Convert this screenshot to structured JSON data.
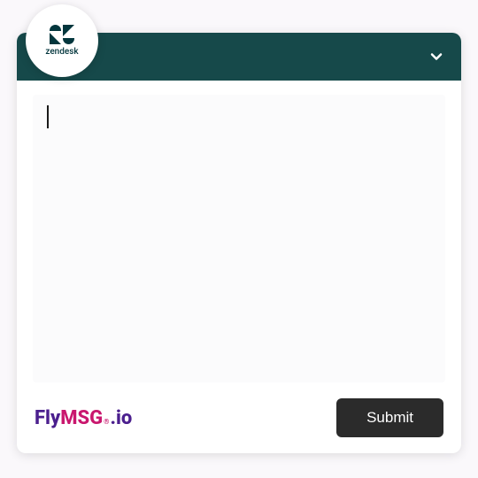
{
  "zendesk": {
    "label": "zendesk"
  },
  "header": {
    "collapse": "collapse"
  },
  "message": {
    "value": ""
  },
  "footer": {
    "brand_fly": "Fly",
    "brand_msg": "MSG",
    "brand_reg": "®",
    "brand_io": ".io",
    "submit_label": "Submit"
  }
}
